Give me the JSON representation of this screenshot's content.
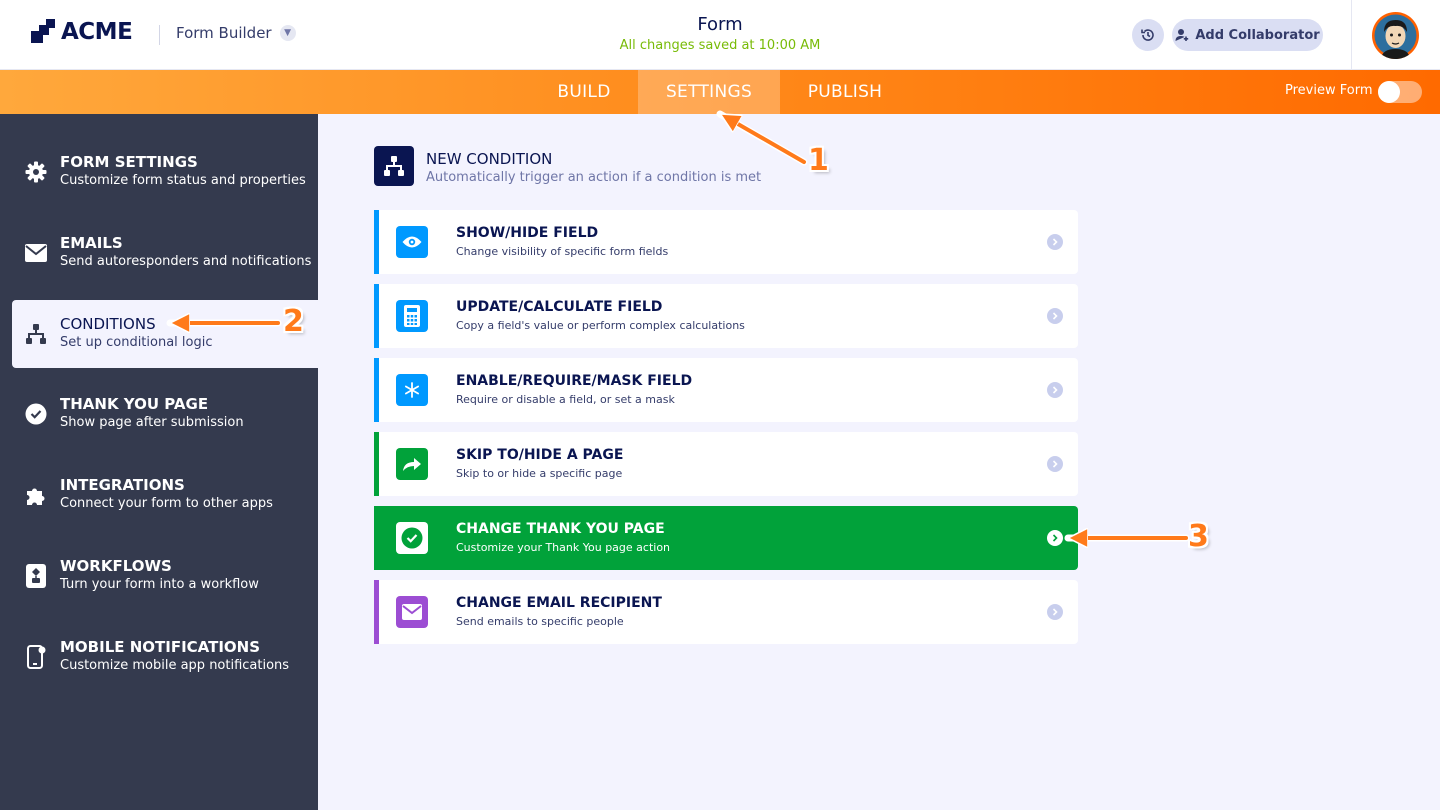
{
  "header": {
    "logo_text": "ACME",
    "app_name": "Form Builder",
    "form_title": "Form",
    "save_status": "All changes saved at 10:00 AM",
    "collaborator_label": "Add Collaborator"
  },
  "tabs": {
    "build": "BUILD",
    "settings": "SETTINGS",
    "publish": "PUBLISH",
    "active": "SETTINGS",
    "preview_label": "Preview Form",
    "preview_on": false
  },
  "sidebar": {
    "items": [
      {
        "title": "FORM SETTINGS",
        "subtitle": "Customize form status and properties",
        "icon": "gear-icon"
      },
      {
        "title": "EMAILS",
        "subtitle": "Send autoresponders and notifications",
        "icon": "envelope-icon"
      },
      {
        "title": "CONDITIONS",
        "subtitle": "Set up conditional logic",
        "icon": "sitemap-icon",
        "active": true
      },
      {
        "title": "THANK YOU PAGE",
        "subtitle": "Show page after submission",
        "icon": "check-circle-icon"
      },
      {
        "title": "INTEGRATIONS",
        "subtitle": "Connect your form to other apps",
        "icon": "puzzle-icon"
      },
      {
        "title": "WORKFLOWS",
        "subtitle": "Turn your form into a workflow",
        "icon": "workflow-icon"
      },
      {
        "title": "MOBILE NOTIFICATIONS",
        "subtitle": "Customize mobile app notifications",
        "icon": "mobile-notification-icon"
      }
    ]
  },
  "main": {
    "new_condition_title": "NEW CONDITION",
    "new_condition_subtitle": "Automatically trigger an action if a condition is met",
    "cards": [
      {
        "title": "SHOW/HIDE FIELD",
        "subtitle": "Change visibility of specific form fields",
        "icon": "eye-icon",
        "color": "#0099ff"
      },
      {
        "title": "UPDATE/CALCULATE FIELD",
        "subtitle": "Copy a field's value or perform complex calculations",
        "icon": "calculator-icon",
        "color": "#0099ff"
      },
      {
        "title": "ENABLE/REQUIRE/MASK FIELD",
        "subtitle": "Require or disable a field, or set a mask",
        "icon": "asterisk-icon",
        "color": "#0099ff"
      },
      {
        "title": "SKIP TO/HIDE A PAGE",
        "subtitle": "Skip to or hide a specific page",
        "icon": "forward-arrow-icon",
        "color": "#01a23a"
      },
      {
        "title": "CHANGE THANK YOU PAGE",
        "subtitle": "Customize your Thank You page action",
        "icon": "check-circle-icon",
        "color": "#01a23a",
        "highlighted": true
      },
      {
        "title": "CHANGE EMAIL RECIPIENT",
        "subtitle": "Send emails to specific people",
        "icon": "envelope-icon",
        "color": "#9c4dd3"
      }
    ]
  },
  "annotations": {
    "step1": "1",
    "step2": "2",
    "step3": "3",
    "color": "#ff7a1a"
  }
}
